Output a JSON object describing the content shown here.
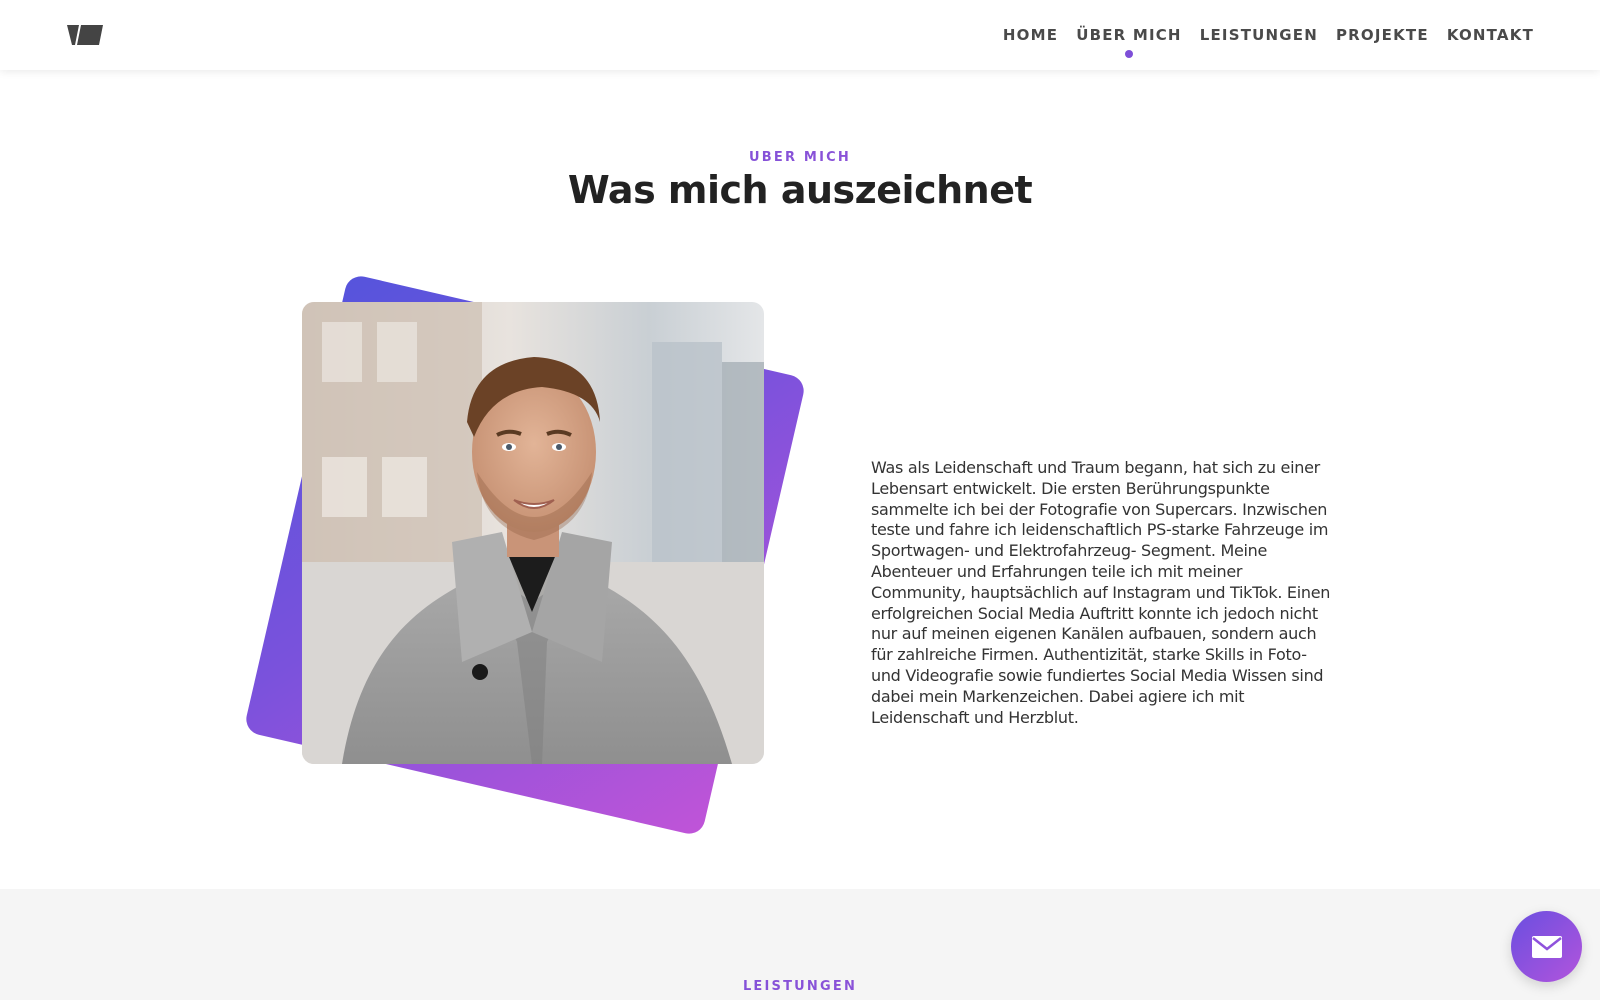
{
  "header": {
    "logo_name": "site-logo",
    "nav": [
      {
        "label": "HOME",
        "active": false
      },
      {
        "label": "ÜBER MICH",
        "active": true
      },
      {
        "label": "LEISTUNGEN",
        "active": false
      },
      {
        "label": "PROJEKTE",
        "active": false
      },
      {
        "label": "KONTAKT",
        "active": false
      }
    ]
  },
  "about": {
    "eyebrow": "ÜBER MICH",
    "title": "Was mich auszeichnet",
    "bio": "Was als Leidenschaft und Traum begann, hat sich zu einer Lebensart entwickelt. Die ersten Berührungspunkte sammelte ich bei der Fotografie von Supercars. Inzwischen teste und fahre ich leidenschaftlich PS-starke Fahrzeuge im Sportwagen- und Elektrofahrzeug- Segment. Meine Abenteuer und Erfahrungen teile ich mit meiner Community, hauptsächlich auf Instagram und TikTok. Einen erfolgreichen Social Media Auftritt konnte ich jedoch nicht nur auf meinen eigenen Kanälen aufbauen, sondern auch für zahlreiche Firmen. Authentizität, starke Skills in Foto- und Videografie sowie fundiertes Social Media Wissen sind dabei mein Markenzeichen. Dabei agiere ich mit Leidenschaft und Herzblut."
  },
  "services": {
    "eyebrow": "LEISTUNGEN"
  },
  "fab": {
    "icon": "mail-icon"
  },
  "colors": {
    "accent_start": "#5b4fd8",
    "accent_end": "#b454d8",
    "text_dark": "#222222",
    "nav_text": "#4a4a4a",
    "section_gray": "#f5f5f5"
  }
}
